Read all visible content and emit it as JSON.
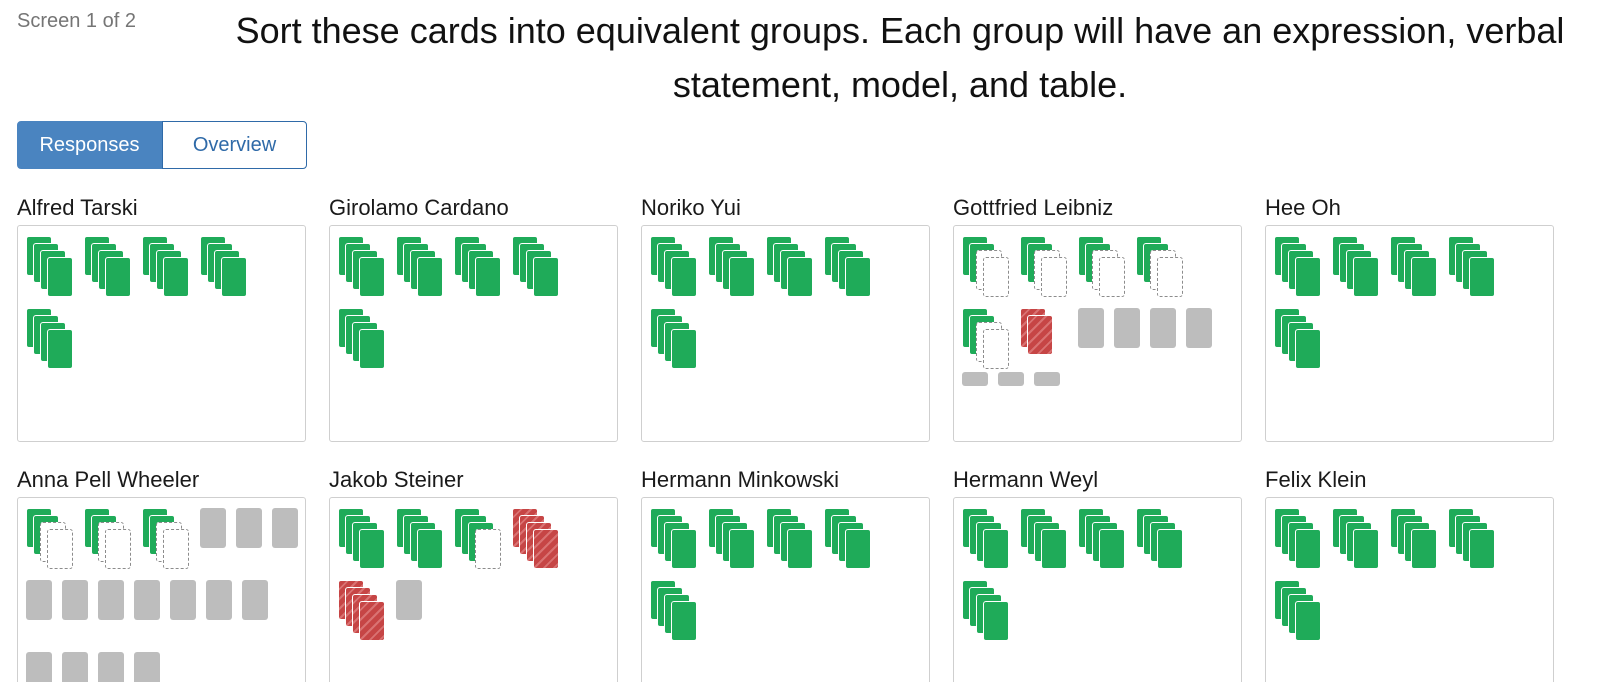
{
  "screen_label": "Screen 1 of 2",
  "prompt": "Sort these cards into equivalent groups. Each group will have an expression, verbal statement, model, and table.",
  "tabs": [
    {
      "label": "Responses",
      "active": true
    },
    {
      "label": "Overview",
      "active": false
    }
  ],
  "colors": {
    "correct_group": "#1fab59",
    "incorrect_group": "#c64545",
    "ungrouped_card": "#bdbdbd",
    "tab_active": "#4a84c0"
  },
  "students": [
    {
      "name": "Alfred Tarski",
      "groups": [
        "correct",
        "correct",
        "correct",
        "correct",
        "correct"
      ],
      "loose_cards": 0,
      "loose_small_cards": 0
    },
    {
      "name": "Girolamo Cardano",
      "groups": [
        "correct",
        "correct",
        "correct",
        "correct",
        "correct"
      ],
      "loose_cards": 0,
      "loose_small_cards": 0
    },
    {
      "name": "Noriko Yui",
      "groups": [
        "correct",
        "correct",
        "correct",
        "correct",
        "correct"
      ],
      "loose_cards": 0,
      "loose_small_cards": 0
    },
    {
      "name": "Gottfried Leibniz",
      "groups": [
        "partial1",
        "partial1",
        "partial1",
        "partial1",
        "partial1",
        "incorrect2"
      ],
      "loose_cards": 4,
      "loose_small_cards": 3
    },
    {
      "name": "Hee Oh",
      "groups": [
        "correct",
        "correct",
        "correct",
        "correct",
        "correct"
      ],
      "loose_cards": 0,
      "loose_small_cards": 0
    },
    {
      "name": "Anna Pell Wheeler",
      "groups": [
        "partial1",
        "partial1",
        "partial1"
      ],
      "loose_cards": 14,
      "loose_small_cards": 0
    },
    {
      "name": "Jakob Steiner",
      "groups": [
        "correct",
        "correct",
        "partial3",
        "incorrect",
        "incorrect"
      ],
      "loose_cards": 1,
      "loose_small_cards": 0
    },
    {
      "name": "Hermann Minkowski",
      "groups": [
        "correct",
        "correct",
        "correct",
        "correct",
        "correct"
      ],
      "loose_cards": 0,
      "loose_small_cards": 0
    },
    {
      "name": "Hermann Weyl",
      "groups": [
        "correct",
        "correct",
        "correct",
        "correct",
        "correct"
      ],
      "loose_cards": 0,
      "loose_small_cards": 0
    },
    {
      "name": "Felix Klein",
      "groups": [
        "correct",
        "correct",
        "correct",
        "correct",
        "correct"
      ],
      "loose_cards": 0,
      "loose_small_cards": 0
    }
  ]
}
